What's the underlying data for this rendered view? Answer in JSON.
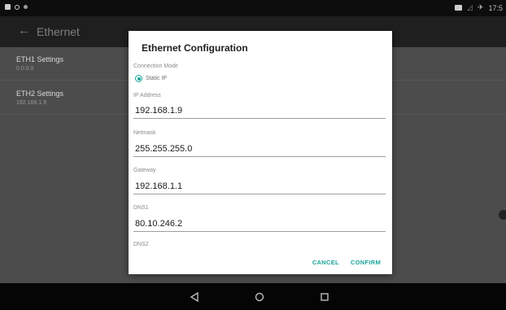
{
  "status_bar": {
    "time": "17:5"
  },
  "toolbar": {
    "back_glyph": "←",
    "title": "Ethernet"
  },
  "list": [
    {
      "title": "ETH1 Settings",
      "subtitle": "0.0.0.0"
    },
    {
      "title": "ETH2 Settings",
      "subtitle": "192.168.1.9"
    }
  ],
  "dialog": {
    "title": "Ethernet Configuration",
    "connection_mode_label": "Connection Mode",
    "connection_mode_value": "Static IP",
    "fields": [
      {
        "label": "IP Address",
        "value": "192.168.1.9"
      },
      {
        "label": "Netmask",
        "value": "255.255.255.0"
      },
      {
        "label": "Gateway",
        "value": "192.168.1.1"
      },
      {
        "label": "DNS1",
        "value": "80.10.246.2"
      },
      {
        "label": "DNS2",
        "value": ""
      }
    ],
    "cancel_label": "CANCEL",
    "confirm_label": "CONFIRM"
  },
  "colors": {
    "accent": "#1aa39a"
  },
  "icons": [
    "notification-icon",
    "circle-icon",
    "dot-icon",
    "screenshot-icon",
    "signal-icon",
    "airplane-icon",
    "back-arrow-icon",
    "nav-back-icon",
    "nav-home-icon",
    "nav-recents-icon",
    "radio-selected-icon"
  ]
}
